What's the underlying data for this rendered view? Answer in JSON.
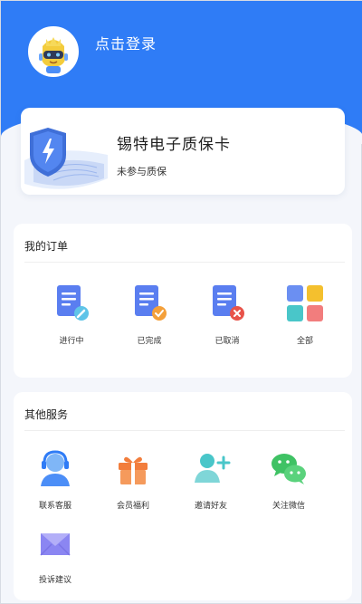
{
  "header": {
    "login_text": "点击登录"
  },
  "warranty": {
    "title": "锡特电子质保卡",
    "subtitle": "未参与质保"
  },
  "orders": {
    "title": "我的订单",
    "items": [
      {
        "label": "进行中",
        "icon": "doc-wrench-icon"
      },
      {
        "label": "已完成",
        "icon": "doc-check-icon"
      },
      {
        "label": "已取消",
        "icon": "doc-cancel-icon"
      },
      {
        "label": "全部",
        "icon": "grid-all-icon"
      }
    ]
  },
  "services": {
    "title": "其他服务",
    "items": [
      {
        "label": "联系客服",
        "icon": "headset-icon"
      },
      {
        "label": "会员福利",
        "icon": "gift-icon"
      },
      {
        "label": "邀请好友",
        "icon": "add-friend-icon"
      },
      {
        "label": "关注微信",
        "icon": "wechat-icon"
      },
      {
        "label": "投诉建议",
        "icon": "feedback-mail-icon"
      }
    ]
  },
  "colors": {
    "brand_blue": "#2f7cf6",
    "page_bg": "#f4f6fb",
    "orange": "#f4a03a",
    "red": "#e8534a",
    "green": "#3fc264",
    "teal": "#49c6c9",
    "purple": "#8b86f2"
  }
}
